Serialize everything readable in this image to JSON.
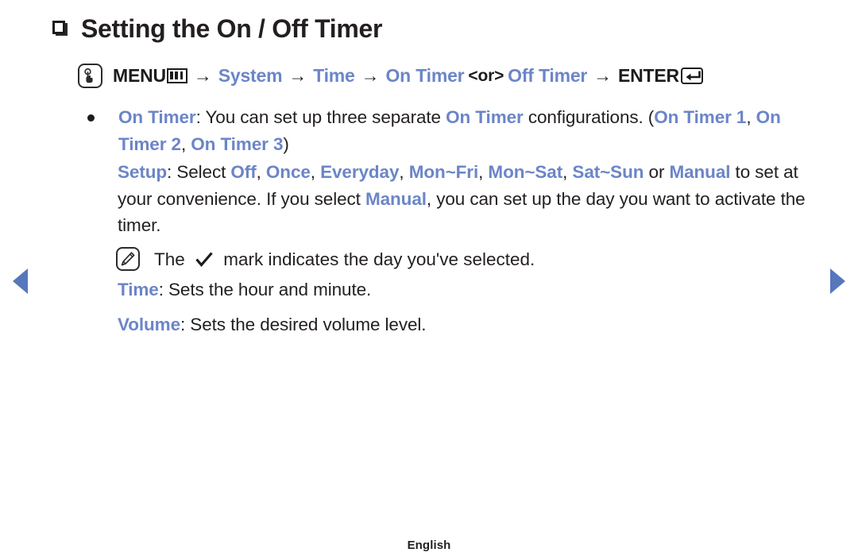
{
  "page": {
    "title": "Setting the On / Off Timer",
    "footer_language": "English",
    "accent_blue": "#6b85c8",
    "nav_arrow_blue": "#5777bd",
    "text_color": "#231f20"
  },
  "menu_path": {
    "press_icon": "press-button-icon",
    "menu_label": "MENU",
    "menu_glyph": "menu-bars-icon",
    "arrow": "→",
    "steps": [
      {
        "label": "System",
        "style": "blue"
      },
      {
        "label": "Time",
        "style": "blue"
      }
    ],
    "on_timer": "On Timer",
    "or_label": "<or>",
    "off_timer": "Off Timer",
    "enter_label": "ENTER",
    "enter_glyph": "enter-return-icon"
  },
  "content": {
    "bullet": {
      "term": "On Timer",
      "text_1": ": You can set up three separate ",
      "term_2": "On Timer",
      "text_2": " configurations. (",
      "term_3": "On Timer 1",
      "sep_1": ", ",
      "term_4": "On Timer 2",
      "sep_2": ", ",
      "term_5": "On Timer 3",
      "text_3": ")"
    },
    "setup": {
      "term": "Setup",
      "text_1": ": Select ",
      "options": [
        "Off",
        "Once",
        "Everyday",
        "Mon~Fri",
        "Mon~Sat",
        "Sat~Sun"
      ],
      "text_2": " or ",
      "manual_1": "Manual",
      "text_3": " to set at your convenience. If you select ",
      "manual_2": "Manual",
      "text_4": ", you can set up the day you want to activate the timer."
    },
    "note": {
      "icon": "note-pencil-icon",
      "text_1": "The ",
      "check_icon": "check-mark-icon",
      "text_2": " mark indicates the day you've selected."
    },
    "time": {
      "term": "Time",
      "text": ": Sets the hour and minute."
    },
    "volume": {
      "term": "Volume",
      "text": ": Sets the desired volume level."
    }
  },
  "navigation": {
    "prev_label": "previous-page-arrow",
    "next_label": "next-page-arrow"
  }
}
